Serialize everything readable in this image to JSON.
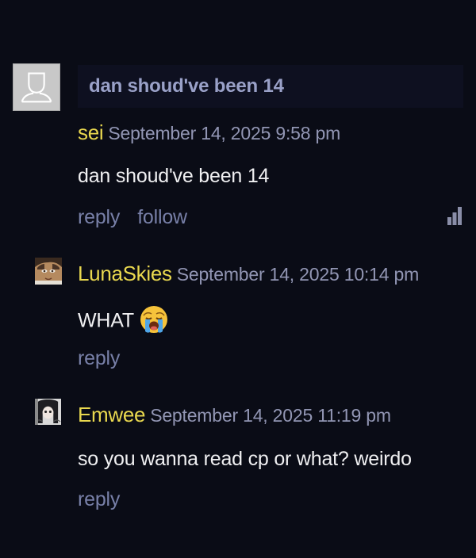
{
  "thread": {
    "reply_to_text": "dan shoud've been 14"
  },
  "comments": [
    {
      "author": "sei",
      "date": "September 14, 2025 9:58 pm",
      "text": "dan shoud've been 14",
      "actions": [
        "reply",
        "follow"
      ],
      "avatar": "default-user-avatar"
    },
    {
      "author": "LunaSkies",
      "date": "September 14, 2025 10:14 pm",
      "text": "WHAT",
      "emoji": "loudly-crying-face",
      "actions": [
        "reply"
      ],
      "avatar": "anime-character-avatar"
    },
    {
      "author": "Emwee",
      "date": "September 14, 2025 11:19 pm",
      "text": "so you wanna read cp or what? weirdo",
      "actions": [
        "reply"
      ],
      "avatar": "anime-character-avatar"
    }
  ],
  "colors": {
    "background": "#0a0c16",
    "author": "#e9d84f",
    "date": "#9296b4",
    "link": "#7880a8",
    "reply_to": "#9aa1c8"
  }
}
